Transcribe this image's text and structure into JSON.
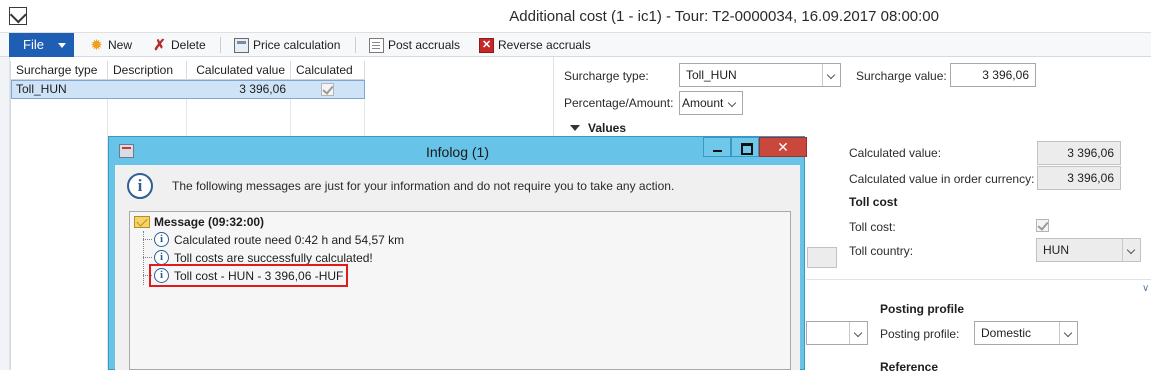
{
  "window": {
    "title": "Additional cost (1 - ic1) - Tour: T2-0000034, 16.09.2017 08:00:00"
  },
  "toolbar": {
    "file_label": "File",
    "new_label": "New",
    "delete_label": "Delete",
    "price_calc_label": "Price calculation",
    "post_accruals_label": "Post accruals",
    "reverse_accruals_label": "Reverse accruals"
  },
  "grid": {
    "columns": [
      "Surcharge type",
      "Description",
      "Calculated value",
      "Calculated"
    ],
    "rows": [
      {
        "surcharge_type": "Toll_HUN",
        "description": "",
        "calculated_value": "3 396,06",
        "calculated": true
      }
    ]
  },
  "details": {
    "surcharge_type_label": "Surcharge type:",
    "surcharge_type_value": "Toll_HUN",
    "surcharge_value_label": "Surcharge value:",
    "surcharge_value": "3 396,06",
    "percentage_amount_label": "Percentage/Amount:",
    "percentage_amount_value": "Amount",
    "values_section": "Values",
    "calculated_value_label": "Calculated value:",
    "calculated_value": "3 396,06",
    "calculated_value_oc_label": "Calculated value in order currency:",
    "calculated_value_oc": "3 396,06",
    "toll_cost_section": "Toll cost",
    "toll_cost_label": "Toll cost:",
    "toll_cost_checked": true,
    "toll_country_label": "Toll country:",
    "toll_country_value": "HUN",
    "posting_profile_section": "Posting profile",
    "posting_profile_label": "Posting profile:",
    "posting_profile_value": "Domestic",
    "reference_section": "Reference"
  },
  "infolog": {
    "title": "Infolog (1)",
    "header_message": "The following messages are just for your information and do not require you to take any action.",
    "tree_root": "Message (09:32:00)",
    "messages": [
      "Calculated route need  0:42 h and 54,57 km",
      "Toll costs are successfully calculated!",
      "Toll cost - HUN - 3 396,06 -HUF"
    ],
    "close_glyph": "✕"
  },
  "colors": {
    "file_button": "#1f5fb3",
    "infolog_frame": "#67c3e8",
    "close_button": "#c9473b",
    "selected_row": "#cfe3f7",
    "highlight_box": "#e01b1b"
  }
}
